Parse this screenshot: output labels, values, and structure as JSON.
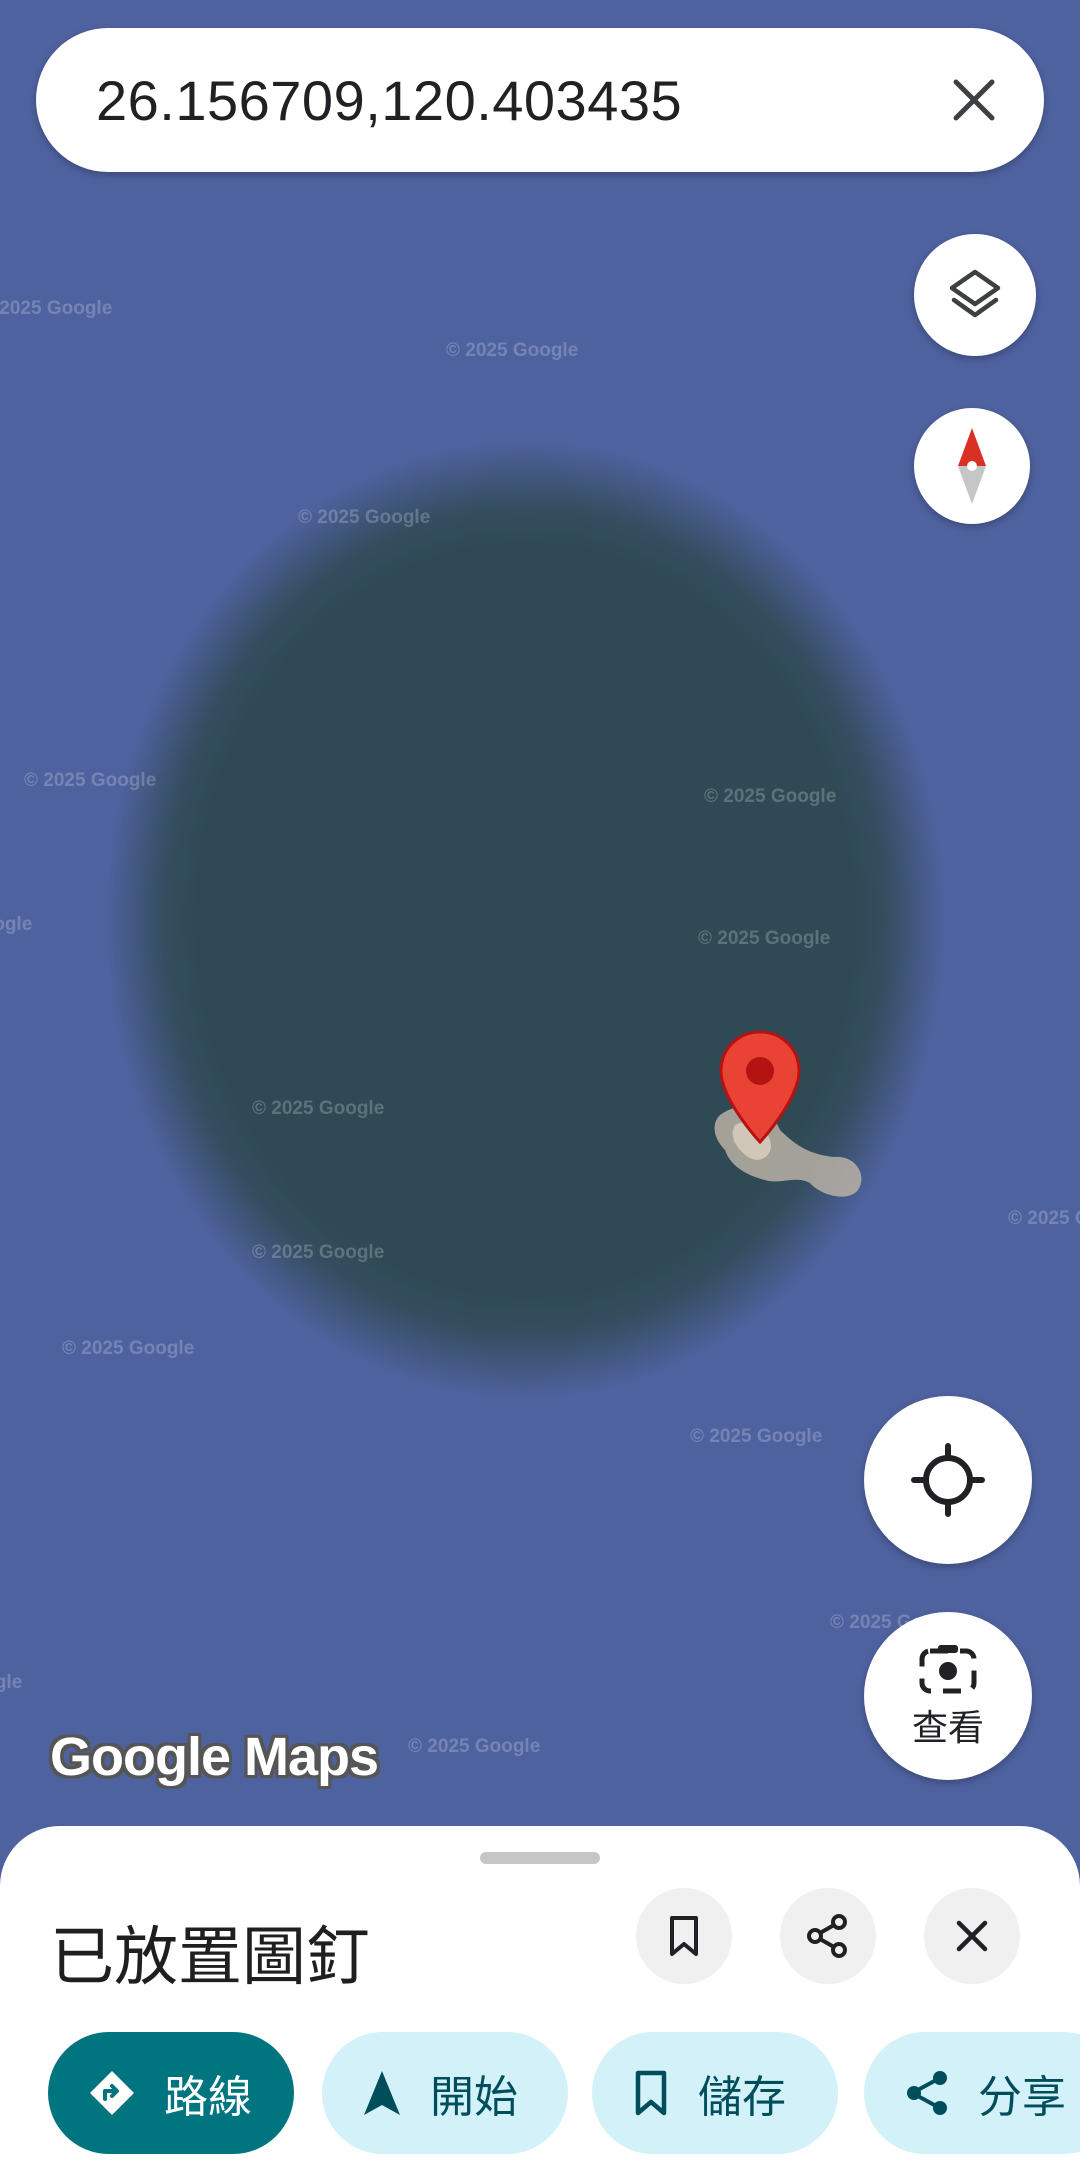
{
  "search": {
    "query": "26.156709,120.403435"
  },
  "map": {
    "watermark": "© 2025 Google"
  },
  "buttons": {
    "lens_label": "查看"
  },
  "branding": {
    "logo_text": "Google Maps"
  },
  "sheet": {
    "title": "已放置圖釘",
    "actions": [
      {
        "label": "路線",
        "icon": "directions-icon"
      },
      {
        "label": "開始",
        "icon": "navigation-arrow-icon"
      },
      {
        "label": "儲存",
        "icon": "bookmark-icon"
      },
      {
        "label": "分享",
        "icon": "share-icon"
      }
    ]
  },
  "colors": {
    "water": "#4f62a0",
    "deep_water": "#2f4a54",
    "pin": "#ea4335",
    "primary_chip": "#00757f",
    "chip": "#d3f1f8"
  }
}
